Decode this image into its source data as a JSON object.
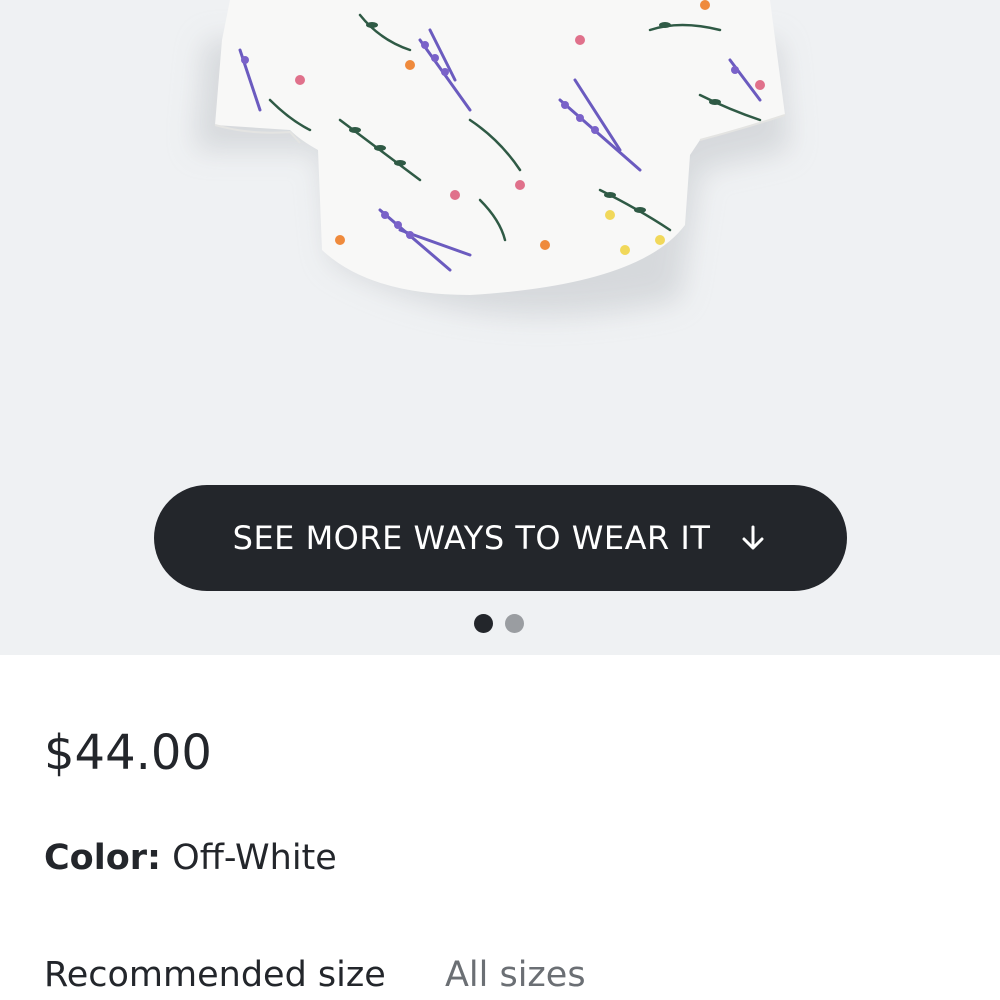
{
  "product": {
    "image_alt": "floral print off-white blouse",
    "cta_label": "SEE MORE WAYS TO WEAR IT",
    "cta_icon": "arrow-down-icon",
    "carousel": {
      "count": 2,
      "active_index": 1
    },
    "price": "$44.00",
    "color_label": "Color:",
    "color_value": "Off-White",
    "recommended_size_label": "Recommended size",
    "all_sizes_label": "All sizes"
  },
  "colors": {
    "image_bg": "#eff1f3",
    "button_bg": "#23262b",
    "text": "#23262b",
    "muted": "#6b6f74"
  }
}
